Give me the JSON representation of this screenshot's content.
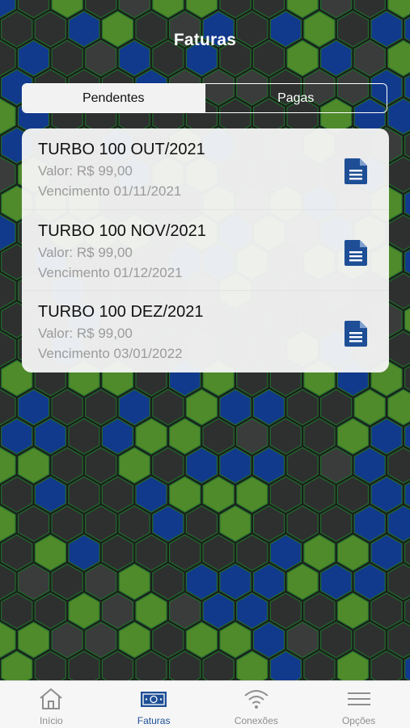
{
  "header": {
    "title": "Faturas"
  },
  "segment": {
    "pending_label": "Pendentes",
    "paid_label": "Pagas",
    "selected": "Pendentes"
  },
  "invoices": [
    {
      "name": "TURBO 100 OUT/2021",
      "value": "Valor: R$ 99,00",
      "due": "Vencimento 01/11/2021",
      "icon": "document-icon"
    },
    {
      "name": "TURBO 100 NOV/2021",
      "value": "Valor: R$ 99,00",
      "due": "Vencimento 01/12/2021",
      "icon": "document-icon"
    },
    {
      "name": "TURBO 100 DEZ/2021",
      "value": "Valor: R$ 99,00",
      "due": "Vencimento 03/01/2022",
      "icon": "document-icon"
    }
  ],
  "tabbar": {
    "selected": "Faturas",
    "items": [
      {
        "label": "Início",
        "icon": "home-icon"
      },
      {
        "label": "Faturas",
        "icon": "banknote-icon"
      },
      {
        "label": "Conexões",
        "icon": "wifi-icon"
      },
      {
        "label": "Opções",
        "icon": "menu-icon"
      }
    ]
  },
  "colors": {
    "accent": "#1e4f96",
    "hex_green": "#4f8a2b",
    "hex_blue": "#123a8c",
    "hex_dark": "#2e302f",
    "hex_outline": "#1f6b2a",
    "background": "#1b1d1c"
  }
}
